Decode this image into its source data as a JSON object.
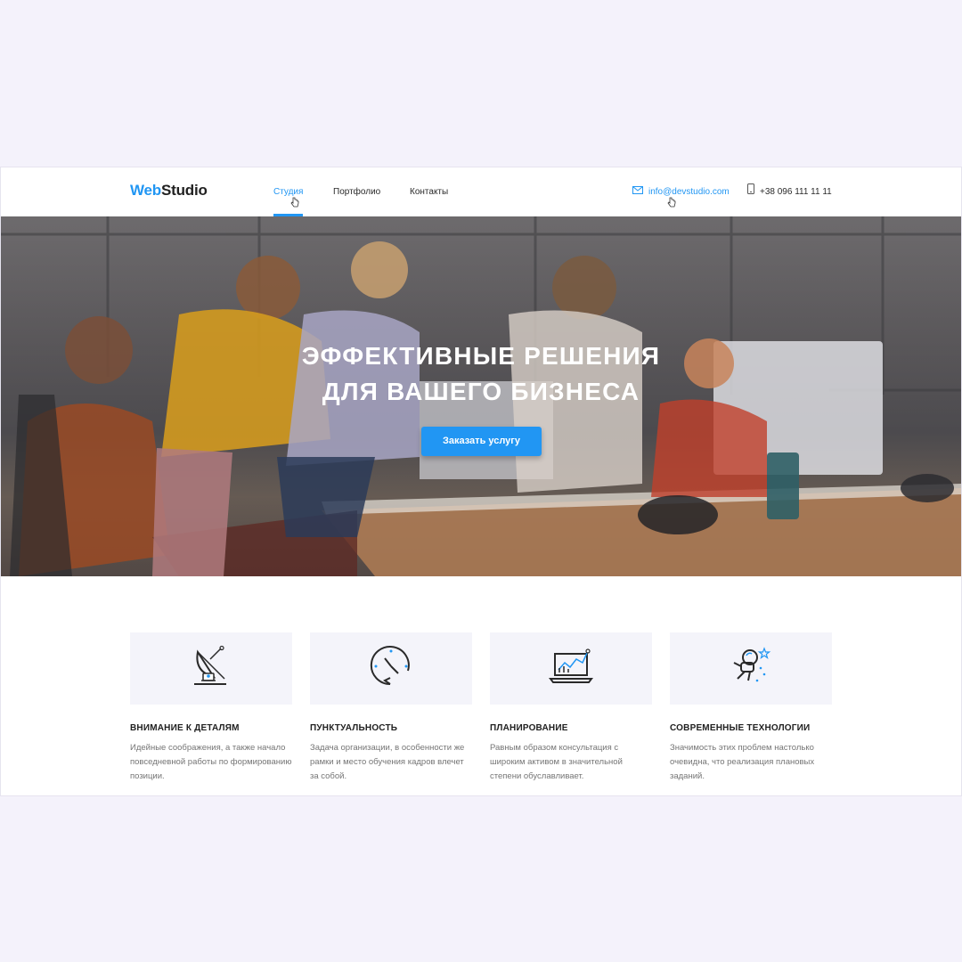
{
  "header": {
    "logo_part1": "Web",
    "logo_part2": "Studio",
    "nav": [
      {
        "label": "Студия"
      },
      {
        "label": "Портфолио"
      },
      {
        "label": "Контакты"
      }
    ],
    "email": "info@devstudio.com",
    "phone": "+38 096 111 11 11"
  },
  "hero": {
    "title_line1": "ЭФФЕКТИВНЫЕ РЕШЕНИЯ",
    "title_line2": "ДЛЯ ВАШЕГО БИЗНЕСА",
    "button_label": "Заказать услугу"
  },
  "features": [
    {
      "icon": "satellite-dish-icon",
      "title": "ВНИМАНИЕ К ДЕТАЛЯМ",
      "text": "Идейные соображения, а также начало повседневной работы по формированию позиции."
    },
    {
      "icon": "clock-icon",
      "title": "ПУНКТУАЛЬНОСТЬ",
      "text": "Задача организации, в особенности же рамки и место обучения кадров влечет за собой."
    },
    {
      "icon": "laptop-chart-icon",
      "title": "ПЛАНИРОВАНИЕ",
      "text": "Равным образом консультация с широким активом в значительной степени обуславливает."
    },
    {
      "icon": "astronaut-icon",
      "title": "СОВРЕМЕННЫЕ ТЕХНОЛОГИИ",
      "text": "Значимость этих проблем настолько очевидна, что реализация плановых заданий."
    }
  ],
  "colors": {
    "accent": "#2196f3",
    "background": "#f4f2fb",
    "feature_box": "#f4f4fa"
  }
}
